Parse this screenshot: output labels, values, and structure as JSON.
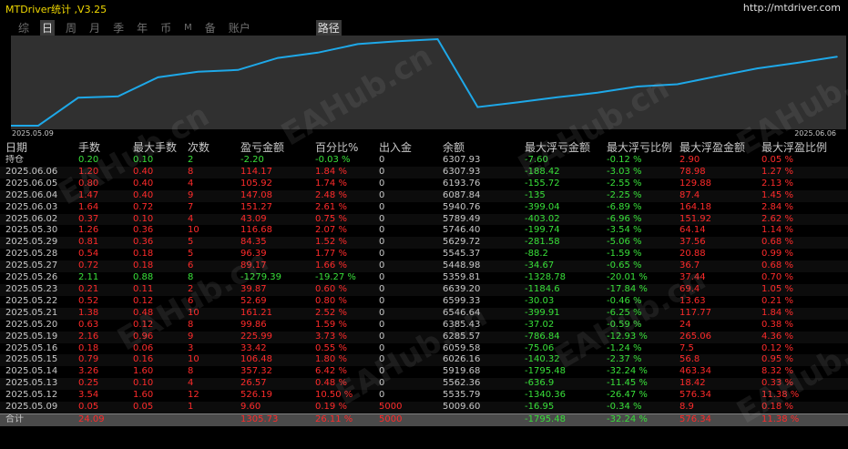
{
  "app": {
    "title": "MTDriver统计 ,V3.25",
    "url": "http://mtdriver.com"
  },
  "tabs": [
    {
      "label": "综",
      "active": false
    },
    {
      "label": "日",
      "active": true
    },
    {
      "label": "周",
      "active": false
    },
    {
      "label": "月",
      "active": false
    },
    {
      "label": "季",
      "active": false
    },
    {
      "label": "年",
      "active": false
    },
    {
      "label": "币",
      "active": false
    },
    {
      "label": "M",
      "active": false
    },
    {
      "label": "备",
      "active": false
    },
    {
      "label": "账户",
      "active": false
    },
    {
      "label": "路径",
      "active": true
    }
  ],
  "chart_data": {
    "type": "line",
    "x": [
      "2025.05.09",
      "2025.05.12",
      "2025.05.13",
      "2025.05.14",
      "2025.05.15",
      "2025.05.16",
      "2025.05.19",
      "2025.05.20",
      "2025.05.21",
      "2025.05.22",
      "2025.05.23",
      "2025.05.26",
      "2025.05.27",
      "2025.05.28",
      "2025.05.29",
      "2025.05.30",
      "2025.06.02",
      "2025.06.03",
      "2025.06.04",
      "2025.06.05",
      "2025.06.06"
    ],
    "values": [
      5009.6,
      5535.79,
      5562.36,
      5919.68,
      6026.16,
      6059.58,
      6285.57,
      6385.43,
      6546.64,
      6599.33,
      6639.2,
      5359.81,
      5448.98,
      5545.37,
      5629.72,
      5746.4,
      5789.49,
      5940.76,
      6087.84,
      6193.76,
      6307.93
    ],
    "start_label": "2025.05.09",
    "end_label": "2025.06.06",
    "line_color": "#1ea8e8",
    "background": "#303030"
  },
  "table": {
    "headers": [
      "日期",
      "手数",
      "最大手数",
      "次数",
      "盈亏金额",
      "百分比%",
      "出入金",
      "余额",
      "最大浮亏金额",
      "最大浮亏比例",
      "最大浮盈金额",
      "最大浮盈比例"
    ],
    "hold": [
      "持仓",
      "0.20",
      "0.10",
      "2",
      "-2.20",
      "-0.03 %",
      "0",
      "6307.93",
      "-7.60",
      "-0.12 %",
      "2.90",
      "0.05 %"
    ],
    "rows": [
      [
        "2025.06.06",
        "1.20",
        "0.40",
        "8",
        "114.17",
        "1.84 %",
        "0",
        "6307.93",
        "-188.42",
        "-3.03 %",
        "78.98",
        "1.27 %"
      ],
      [
        "2025.06.05",
        "0.80",
        "0.40",
        "4",
        "105.92",
        "1.74 %",
        "0",
        "6193.76",
        "-155.72",
        "-2.55 %",
        "129.88",
        "2.13 %"
      ],
      [
        "2025.06.04",
        "1.47",
        "0.40",
        "9",
        "147.08",
        "2.48 %",
        "0",
        "6087.84",
        "-135",
        "-2.25 %",
        "87.4",
        "1.45 %"
      ],
      [
        "2025.06.03",
        "1.64",
        "0.72",
        "7",
        "151.27",
        "2.61 %",
        "0",
        "5940.76",
        "-399.04",
        "-6.89 %",
        "164.18",
        "2.84 %"
      ],
      [
        "2025.06.02",
        "0.37",
        "0.10",
        "4",
        "43.09",
        "0.75 %",
        "0",
        "5789.49",
        "-403.02",
        "-6.96 %",
        "151.92",
        "2.62 %"
      ],
      [
        "2025.05.30",
        "1.26",
        "0.36",
        "10",
        "116.68",
        "2.07 %",
        "0",
        "5746.40",
        "-199.74",
        "-3.54 %",
        "64.14",
        "1.14 %"
      ],
      [
        "2025.05.29",
        "0.81",
        "0.36",
        "5",
        "84.35",
        "1.52 %",
        "0",
        "5629.72",
        "-281.58",
        "-5.06 %",
        "37.56",
        "0.68 %"
      ],
      [
        "2025.05.28",
        "0.54",
        "0.18",
        "5",
        "96.39",
        "1.77 %",
        "0",
        "5545.37",
        "-88.2",
        "-1.59 %",
        "20.88",
        "0.99 %"
      ],
      [
        "2025.05.27",
        "0.72",
        "0.18",
        "6",
        "89.17",
        "1.66 %",
        "0",
        "5448.98",
        "-34.67",
        "-0.65 %",
        "36.7",
        "0.68 %"
      ],
      [
        "2025.05.26",
        "2.11",
        "0.88",
        "8",
        "-1279.39",
        "-19.27 %",
        "0",
        "5359.81",
        "-1328.78",
        "-20.01 %",
        "37.44",
        "0.70 %"
      ],
      [
        "2025.05.23",
        "0.21",
        "0.11",
        "2",
        "39.87",
        "0.60 %",
        "0",
        "6639.20",
        "-1184.6",
        "-17.84 %",
        "69.4",
        "1.05 %"
      ],
      [
        "2025.05.22",
        "0.52",
        "0.12",
        "6",
        "52.69",
        "0.80 %",
        "0",
        "6599.33",
        "-30.03",
        "-0.46 %",
        "13.63",
        "0.21 %"
      ],
      [
        "2025.05.21",
        "1.38",
        "0.48",
        "10",
        "161.21",
        "2.52 %",
        "0",
        "6546.64",
        "-399.91",
        "-6.25 %",
        "117.77",
        "1.84 %"
      ],
      [
        "2025.05.20",
        "0.63",
        "0.12",
        "8",
        "99.86",
        "1.59 %",
        "0",
        "6385.43",
        "-37.02",
        "-0.59 %",
        "24",
        "0.38 %"
      ],
      [
        "2025.05.19",
        "2.16",
        "0.96",
        "9",
        "225.99",
        "3.73 %",
        "0",
        "6285.57",
        "-786.84",
        "-12.93 %",
        "265.06",
        "4.36 %"
      ],
      [
        "2025.05.16",
        "0.18",
        "0.06",
        "3",
        "33.42",
        "0.55 %",
        "0",
        "6059.58",
        "-75.06",
        "-1.24 %",
        "7.5",
        "0.12 %"
      ],
      [
        "2025.05.15",
        "0.79",
        "0.16",
        "10",
        "106.48",
        "1.80 %",
        "0",
        "6026.16",
        "-140.32",
        "-2.37 %",
        "56.8",
        "0.95 %"
      ],
      [
        "2025.05.14",
        "3.26",
        "1.60",
        "8",
        "357.32",
        "6.42 %",
        "0",
        "5919.68",
        "-1795.48",
        "-32.24 %",
        "463.34",
        "8.32 %"
      ],
      [
        "2025.05.13",
        "0.25",
        "0.10",
        "4",
        "26.57",
        "0.48 %",
        "0",
        "5562.36",
        "-636.9",
        "-11.45 %",
        "18.42",
        "0.33 %"
      ],
      [
        "2025.05.12",
        "3.54",
        "1.60",
        "12",
        "526.19",
        "10.50 %",
        "0",
        "5535.79",
        "-1340.36",
        "-26.47 %",
        "576.34",
        "11.38 %"
      ],
      [
        "2025.05.09",
        "0.05",
        "0.05",
        "1",
        "9.60",
        "0.19 %",
        "5000",
        "5009.60",
        "-16.95",
        "-0.34 %",
        "8.9",
        "0.18 %"
      ]
    ],
    "total": [
      "合计",
      "24.09",
      "",
      "",
      "1305.73",
      "26.11 %",
      "5000",
      "",
      "-1795.48",
      "-32.24 %",
      "576.34",
      "11.38 %"
    ]
  },
  "colors": {
    "positive": "#ff2b2b",
    "negative": "#39e03a",
    "title": "#f0d800"
  }
}
